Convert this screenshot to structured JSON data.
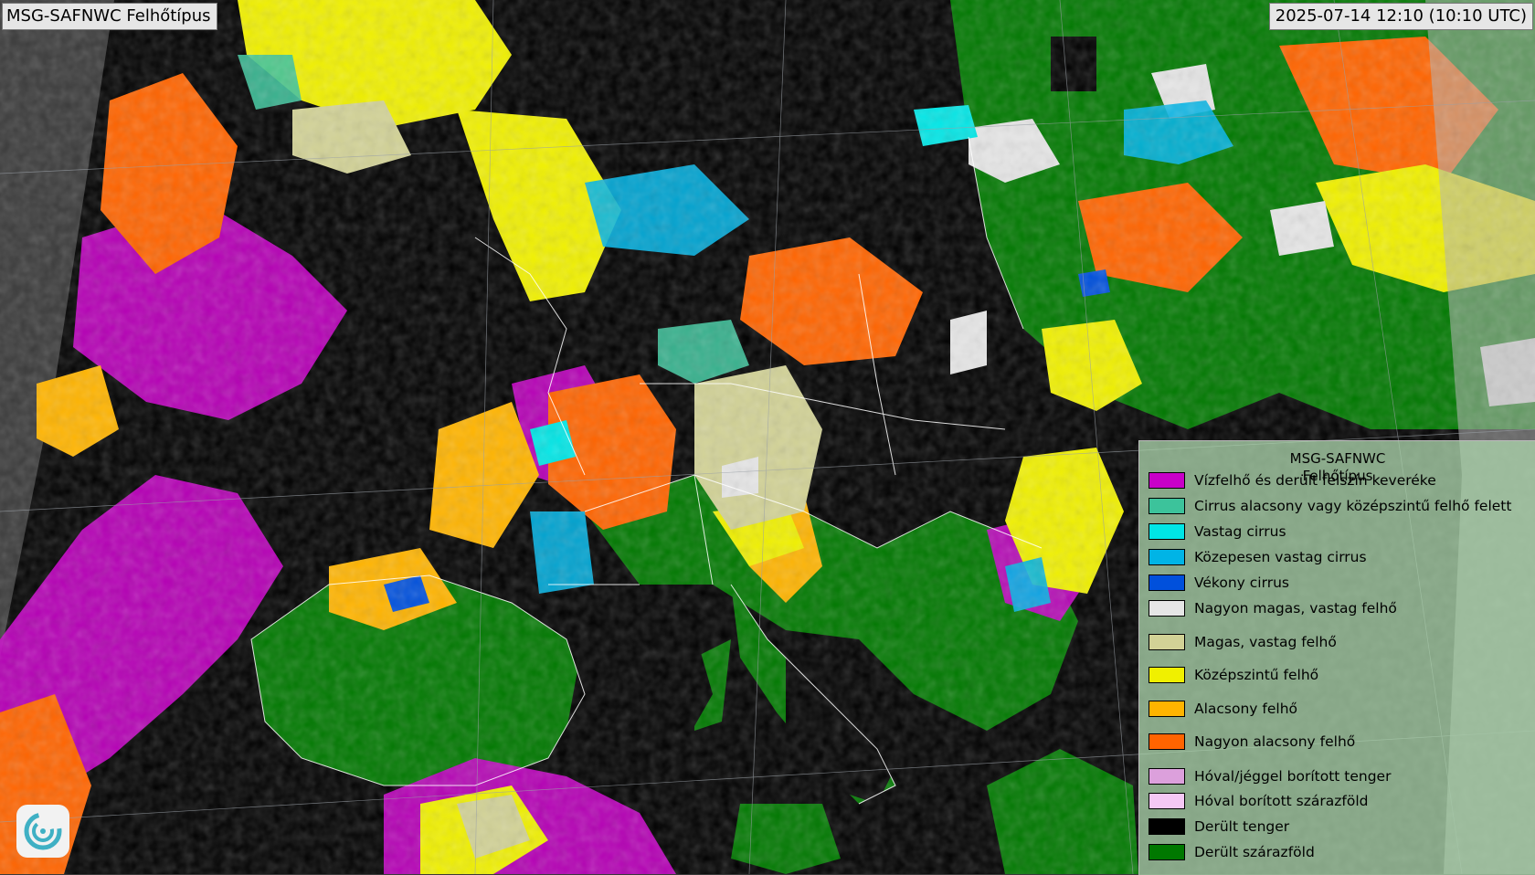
{
  "header": {
    "title": "MSG-SAFNWC Felhőtípus",
    "timestamp": "2025-07-14 12:10 (10:10 UTC)"
  },
  "legend": {
    "title_line1": "MSG-SAFNWC",
    "title_line2": "Felhőtípus",
    "items": [
      {
        "label": "Vízfelhő és derült felszín keveréke",
        "color": "#c800c8"
      },
      {
        "label": "Cirrus alacsony vagy középszintű felhő felett",
        "color": "#3cc39b"
      },
      {
        "label": "Vastag cirrus",
        "color": "#00e6e6"
      },
      {
        "label": "Közepesen vastag cirrus",
        "color": "#00b4e6"
      },
      {
        "label": "Vékony cirrus",
        "color": "#0050dc"
      },
      {
        "label": "Nagyon magas, vastag felhő",
        "color": "#e6e6e6"
      },
      {
        "label": "Magas, vastag felhő",
        "color": "#d2d296"
      },
      {
        "label": "Középszintű felhő",
        "color": "#f0f000"
      },
      {
        "label": "Alacsony felhő",
        "color": "#ffb400"
      },
      {
        "label": "Nagyon alacsony felhő",
        "color": "#ff6400"
      },
      {
        "label": "Hóval/jéggel borított tenger",
        "color": "#dca0dc"
      },
      {
        "label": "Hóval borított szárazföld",
        "color": "#f5c8f5"
      },
      {
        "label": "Derült tenger",
        "color": "#000000"
      },
      {
        "label": "Derült szárazföld",
        "color": "#007800"
      }
    ]
  },
  "logo": {
    "icon": "swirl-logo-icon"
  }
}
